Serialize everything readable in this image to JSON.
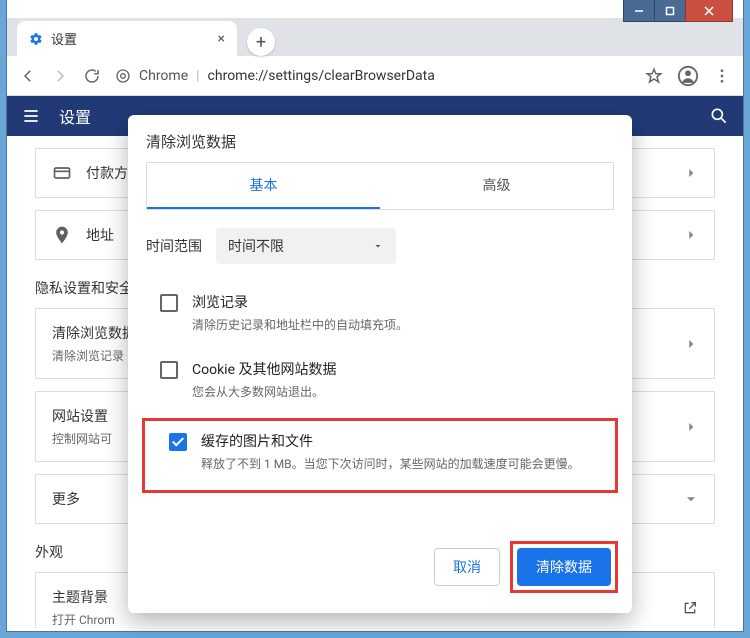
{
  "window": {
    "tab_title": "设置",
    "address_prefix": "Chrome",
    "address_url": "chrome://settings/clearBrowserData"
  },
  "header": {
    "title": "设置"
  },
  "settings": {
    "rows": [
      {
        "icon": "credit-card",
        "label": "付款方式"
      },
      {
        "icon": "location",
        "label": "地址"
      }
    ],
    "section_privacy": "隐私设置和安全",
    "privacy_rows": [
      {
        "label": "清除浏览数据",
        "sub": "清除浏览记录"
      },
      {
        "label": "网站设置",
        "sub": "控制网站可"
      },
      {
        "label": "更多",
        "sub": ""
      }
    ],
    "section_appearance": "外观",
    "appearance_rows": [
      {
        "label": "主题背景",
        "sub": "打开 Chrom"
      }
    ]
  },
  "dialog": {
    "title": "清除浏览数据",
    "tabs": {
      "basic": "基本",
      "advanced": "高级"
    },
    "range_label": "时间范围",
    "range_value": "时间不限",
    "options": [
      {
        "title": "浏览记录",
        "sub": "清除历史记录和地址栏中的自动填充项。",
        "checked": false
      },
      {
        "title": "Cookie 及其他网站数据",
        "sub": "您会从大多数网站退出。",
        "checked": false
      },
      {
        "title": "缓存的图片和文件",
        "sub": "释放了不到 1 MB。当您下次访问时，某些网站的加载速度可能会更慢。",
        "checked": true
      }
    ],
    "cancel": "取消",
    "confirm": "清除数据"
  }
}
